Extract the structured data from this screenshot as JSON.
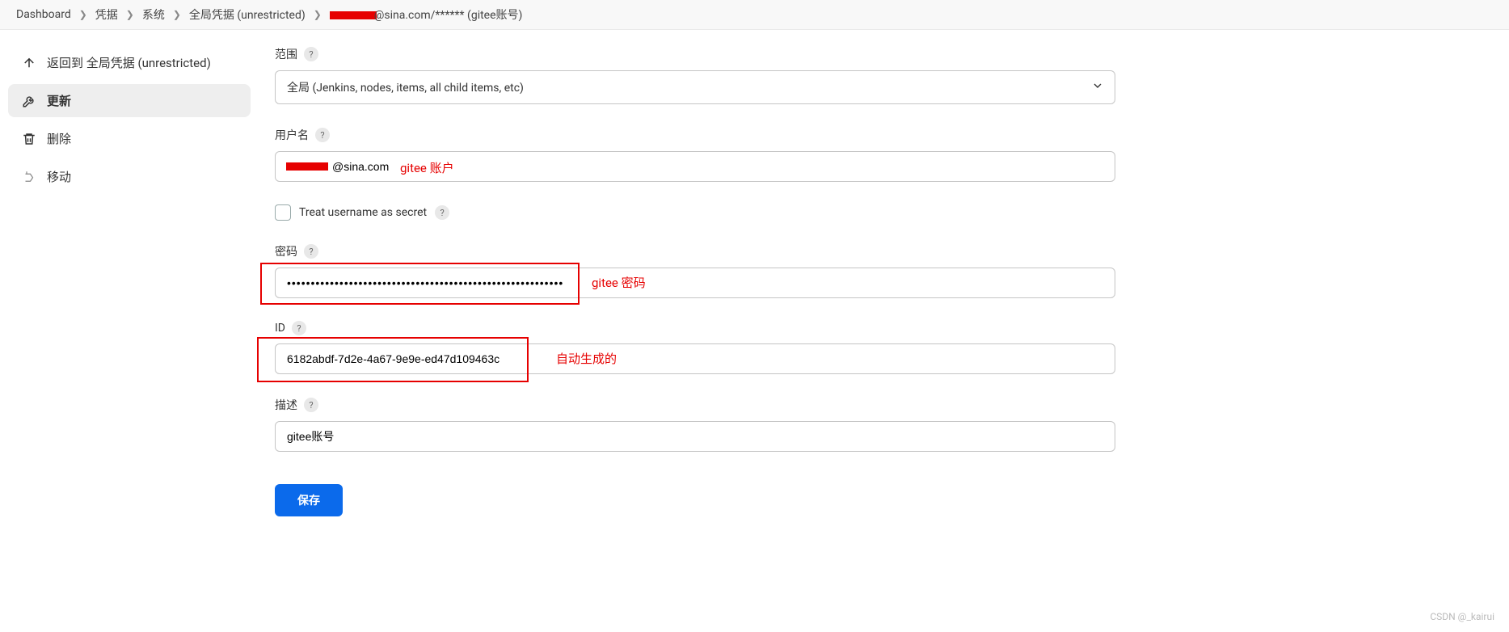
{
  "breadcrumb": {
    "items": [
      "Dashboard",
      "凭据",
      "系统",
      "全局凭据 (unrestricted)"
    ],
    "last_suffix": "@sina.com/****** (gitee账号)"
  },
  "sidebar": {
    "back": "返回到 全局凭据 (unrestricted)",
    "update": "更新",
    "delete": "删除",
    "move": "移动"
  },
  "form": {
    "scope_label": "范围",
    "scope_value": "全局 (Jenkins, nodes, items, all child items, etc)",
    "username_label": "用户名",
    "username_value_suffix": "@sina.com",
    "treat_secret_label": "Treat username as secret",
    "password_label": "密码",
    "password_value": "••••••••••••••••••••••••••••••••••••••••••••••••••••••••••",
    "id_label": "ID",
    "id_value": "6182abdf-7d2e-4a67-9e9e-ed47d109463c",
    "desc_label": "描述",
    "desc_value": "gitee账号",
    "save_label": "保存"
  },
  "annotations": {
    "gitee_account": "gitee 账户",
    "gitee_password": "gitee 密码",
    "auto_generated": "自动生成的"
  },
  "watermark": "CSDN @_kairui"
}
